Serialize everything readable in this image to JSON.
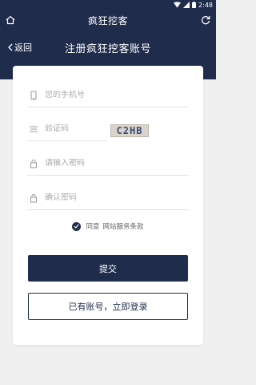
{
  "status_bar": {
    "time": "2:48"
  },
  "app_bar": {
    "title": "疯狂挖客"
  },
  "header": {
    "back_label": "返回",
    "title": "注册疯狂挖客账号"
  },
  "form": {
    "phone_placeholder": "您的手机号",
    "captcha_placeholder": "验证码",
    "captcha_text": "C2HB",
    "password_placeholder": "请输入密码",
    "confirm_placeholder": "确认密码",
    "agree_text": "同意",
    "terms_link": "网站服务条款",
    "submit_label": "提交",
    "login_label": "已有账号，立即登录"
  },
  "colors": {
    "primary": "#1f2c4b",
    "background": "#f0f0f0"
  }
}
